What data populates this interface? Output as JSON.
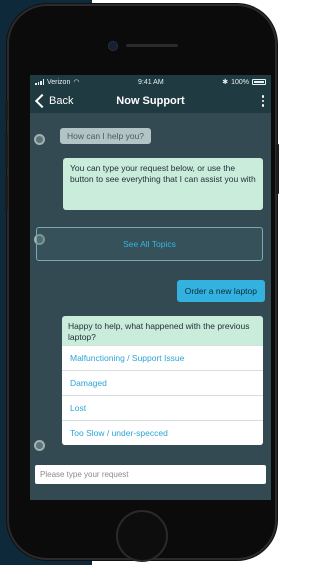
{
  "status_bar": {
    "carrier": "Verizon",
    "time": "9:41 AM",
    "battery": "100%"
  },
  "nav": {
    "back_label": "Back",
    "title": "Now Support"
  },
  "messages": {
    "greeting": "How can I help you?",
    "intro": "You can type your request below, or use the button to see everything that I can assist you with",
    "topics_button": "See All Topics",
    "user_request": "Order a new laptop",
    "followup": "Happy to help, what happened with the previous laptop?"
  },
  "options": [
    "Malfunctioning / Support Issue",
    "Damaged",
    "Lost",
    "Too Slow / under-specced"
  ],
  "composer": {
    "placeholder": "Please type your request"
  },
  "colors": {
    "accent": "#33b2e0",
    "bot_bubble": "#c9ecdb",
    "chat_bg": "#334a52",
    "nav_bg": "#1f3a41"
  }
}
